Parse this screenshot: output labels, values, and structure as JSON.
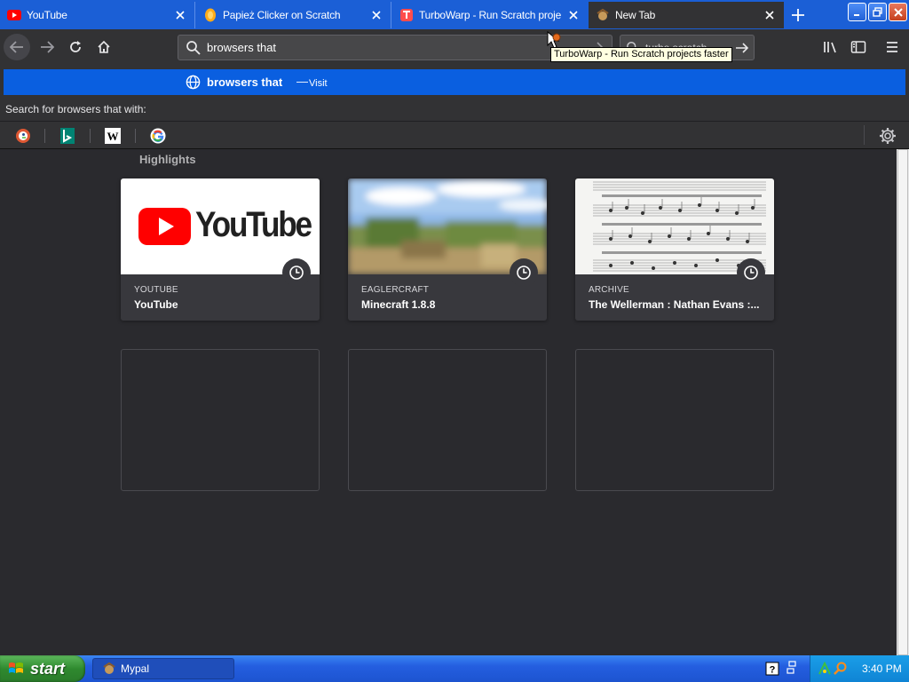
{
  "tabs": [
    {
      "title": "YouTube",
      "icon": "youtube-icon",
      "selected": false
    },
    {
      "title": "Papież Clicker on Scratch",
      "icon": "scratch-icon",
      "selected": false
    },
    {
      "title": "TurboWarp - Run Scratch project",
      "icon": "turbowarp-icon",
      "selected": false
    },
    {
      "title": "New Tab",
      "icon": "newtab-icon",
      "selected": true
    }
  ],
  "navbar": {
    "url_value": "browsers that ",
    "search_value": "turbo scratch"
  },
  "tooltip": {
    "text": "TurboWarp - Run Scratch projects faster"
  },
  "dropdown": {
    "row_text": "browsers that",
    "row_separator": "—",
    "row_action": "Visit",
    "search_for_label": "Search for browsers that  with:",
    "engines": [
      "duckduckgo-icon",
      "bing-icon",
      "wikipedia-icon",
      "google-icon"
    ]
  },
  "content": {
    "section_title": "Highlights",
    "cards": [
      {
        "site": "YOUTUBE",
        "title": "YouTube",
        "thumb_text": "YouTube"
      },
      {
        "site": "EAGLERCRAFT",
        "title": "Minecraft 1.8.8"
      },
      {
        "site": "ARCHIVE",
        "title": "The Wellerman : Nathan Evans :..."
      }
    ]
  },
  "taskbar": {
    "start_label": "start",
    "task_label": "Mypal",
    "clock": "3:40 PM"
  },
  "colors": {
    "tabstrip": "#1b5fd6",
    "toolbar": "#323234",
    "highlight_row": "#0a5fe0",
    "page_bg": "#2a2a2e",
    "card_bg": "#38383d"
  }
}
